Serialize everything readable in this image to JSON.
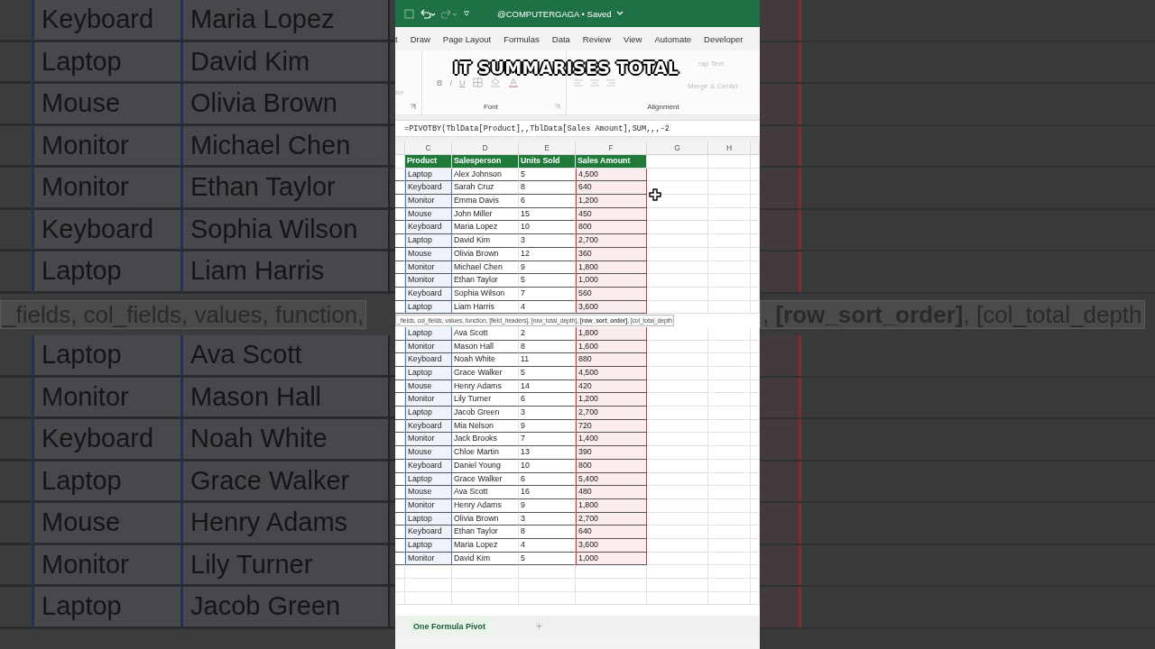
{
  "caption": "IT SUMMARISES TOTAL",
  "backdrop_left": {
    "rows_above": [
      {
        "product": "Keyboard",
        "salesperson": "Maria Lopez"
      },
      {
        "product": "Laptop",
        "salesperson": "David Kim"
      },
      {
        "product": "Mouse",
        "salesperson": "Olivia Brown"
      },
      {
        "product": "Monitor",
        "salesperson": "Michael Chen"
      },
      {
        "product": "Monitor",
        "salesperson": "Ethan Taylor"
      },
      {
        "product": "Keyboard",
        "salesperson": "Sophia Wilson"
      },
      {
        "product": "Laptop",
        "salesperson": "Liam Harris"
      }
    ],
    "tooltip": "_fields, col_fields, values, function,",
    "rows_below": [
      {
        "product": "Laptop",
        "salesperson": "Ava Scott"
      },
      {
        "product": "Monitor",
        "salesperson": "Mason Hall"
      },
      {
        "product": "Keyboard",
        "salesperson": "Noah White"
      },
      {
        "product": "Laptop",
        "salesperson": "Grace Walker"
      },
      {
        "product": "Mouse",
        "salesperson": "Henry Adams"
      },
      {
        "product": "Monitor",
        "salesperson": "Lily Turner"
      },
      {
        "product": "Laptop",
        "salesperson": "Jacob Green"
      }
    ]
  },
  "backdrop_right": {
    "tooltip": ", **[row_sort_order]**, [col_total_depth"
  },
  "title_bar": {
    "account": "@COMPUTERGAGA",
    "separator": "•",
    "status": "Saved"
  },
  "ribbon_tabs": [
    "t",
    "Draw",
    "Page Layout",
    "Formulas",
    "Data",
    "Review",
    "View",
    "Automate",
    "Developer"
  ],
  "ribbon": {
    "cut_label": "ter",
    "font_buttons": [
      "B",
      "I",
      "U"
    ],
    "wrap_text": "rap Text",
    "merge": "Merge & Center",
    "groups": [
      "Font",
      "Alignment"
    ]
  },
  "formula": "=PIVOTBY(TblData[Product],,TblData[Sales Amount],SUM,,,-2",
  "columns": [
    "C",
    "D",
    "E",
    "F",
    "G",
    "H"
  ],
  "table": {
    "headers": [
      {
        "label": "Product",
        "color": "#4a78c2"
      },
      {
        "label": "Salesperson"
      },
      {
        "label": "Units Sold"
      },
      {
        "label": "Sales Amount",
        "color": "#c8383c"
      }
    ],
    "rows_above": [
      [
        "Laptop",
        "Alex Johnson",
        "5",
        "4,500"
      ],
      [
        "Keyboard",
        "Sarah Cruz",
        "8",
        "640"
      ],
      [
        "Monitor",
        "Emma Davis",
        "6",
        "1,200"
      ],
      [
        "Mouse",
        "John Miller",
        "15",
        "450"
      ],
      [
        "Keyboard",
        "Maria Lopez",
        "10",
        "800"
      ],
      [
        "Laptop",
        "David Kim",
        "3",
        "2,700"
      ],
      [
        "Mouse",
        "Olivia Brown",
        "12",
        "360"
      ],
      [
        "Monitor",
        "Michael Chen",
        "9",
        "1,800"
      ],
      [
        "Monitor",
        "Ethan Taylor",
        "5",
        "1,000"
      ],
      [
        "Keyboard",
        "Sophia Wilson",
        "7",
        "560"
      ],
      [
        "Laptop",
        "Liam Harris",
        "4",
        "3,600"
      ]
    ],
    "tooltip": "_fields, col_fields, values, function, [field_headers], [row_total_depth], **[row_sort_order]**, [col_total_depth",
    "rows_below": [
      [
        "Laptop",
        "Ava Scott",
        "2",
        "1,800"
      ],
      [
        "Monitor",
        "Mason Hall",
        "8",
        "1,600"
      ],
      [
        "Keyboard",
        "Noah White",
        "11",
        "880"
      ],
      [
        "Laptop",
        "Grace Walker",
        "5",
        "4,500"
      ],
      [
        "Mouse",
        "Henry Adams",
        "14",
        "420"
      ],
      [
        "Monitor",
        "Lily Turner",
        "6",
        "1,200"
      ],
      [
        "Laptop",
        "Jacob Green",
        "3",
        "2,700"
      ],
      [
        "Keyboard",
        "Mia Nelson",
        "9",
        "720"
      ],
      [
        "Monitor",
        "Jack Brooks",
        "7",
        "1,400"
      ],
      [
        "Mouse",
        "Chloe Martin",
        "13",
        "390"
      ],
      [
        "Keyboard",
        "Daniel Young",
        "10",
        "800"
      ],
      [
        "Laptop",
        "Grace Walker",
        "6",
        "5,400"
      ],
      [
        "Mouse",
        "Ava Scott",
        "16",
        "480"
      ],
      [
        "Monitor",
        "Henry Adams",
        "9",
        "1,800"
      ],
      [
        "Laptop",
        "Olivia Brown",
        "3",
        "2,700"
      ],
      [
        "Keyboard",
        "Ethan Taylor",
        "8",
        "640"
      ],
      [
        "Laptop",
        "Maria Lopez",
        "4",
        "3,600"
      ],
      [
        "Monitor",
        "David Kim",
        "5",
        "1,000"
      ]
    ]
  },
  "sheet_tabs": [
    {
      "label": "One Formula Pivot",
      "selected": true
    }
  ],
  "add_sheet": "+"
}
